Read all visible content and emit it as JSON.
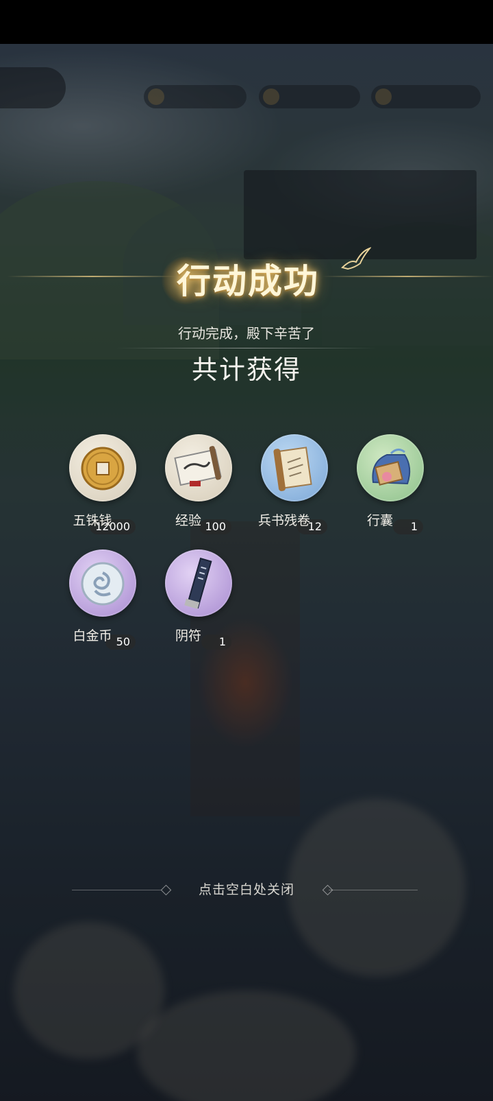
{
  "screen": {
    "title": "行动成功",
    "subtitle": "行动完成，殿下辛苦了",
    "total_heading": "共计获得",
    "close_hint": "点击空白处关闭"
  },
  "rewards": [
    {
      "name": "五铢钱",
      "count": "12000",
      "icon": "coin-icon",
      "bg": "#e8e0d0"
    },
    {
      "name": "经验",
      "count": "100",
      "icon": "scroll-icon",
      "bg": "#e8e0d0"
    },
    {
      "name": "兵书残卷",
      "count": "12",
      "icon": "book-fragment-icon",
      "bg": "#9cc0e6"
    },
    {
      "name": "行囊",
      "count": "1",
      "icon": "pouch-icon",
      "bg": "#a8d4a0"
    },
    {
      "name": "白金币",
      "count": "50",
      "icon": "platinum-coin-icon",
      "bg": "#c0a8e0"
    },
    {
      "name": "阴符",
      "count": "1",
      "icon": "talisman-icon",
      "bg": "#c0a8e0"
    }
  ],
  "colors": {
    "title_glow": "#ffd27a",
    "text_primary": "#f0ede6",
    "count_badge": "#2a2a2a"
  }
}
